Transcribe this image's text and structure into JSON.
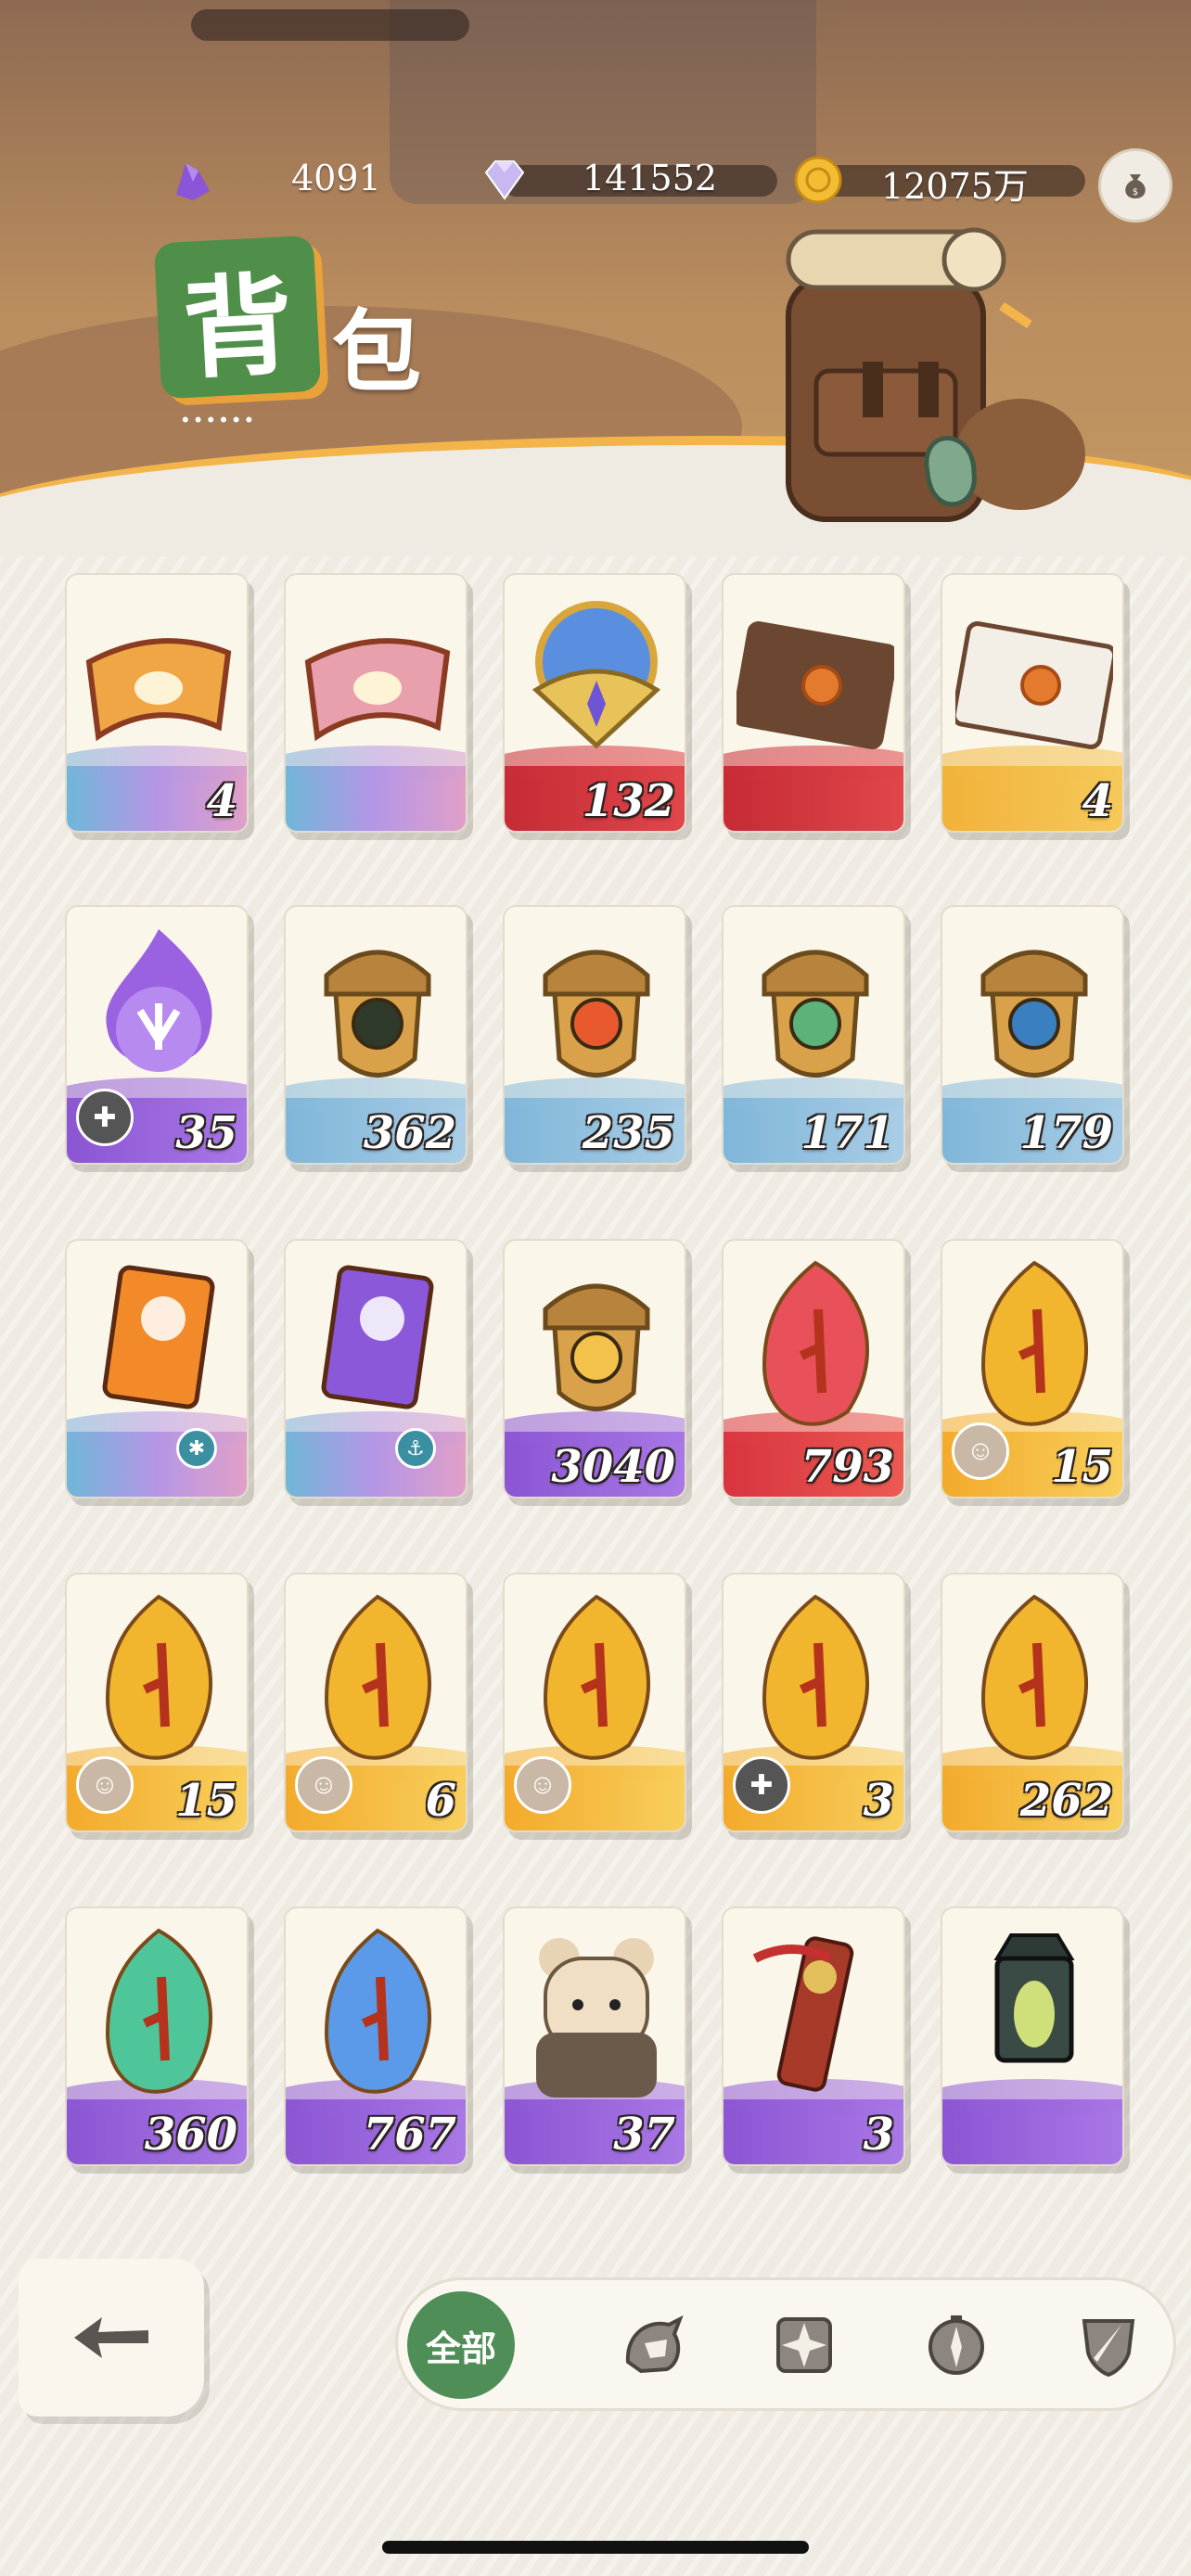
{
  "currencies": [
    {
      "name": "purple-crystal",
      "value": "4091",
      "color": "#8a55d6"
    },
    {
      "name": "diamond",
      "value": "141552",
      "color": "#c9b7f2"
    },
    {
      "name": "gold-coin",
      "value": "12075万",
      "color": "#f2bd32"
    }
  ],
  "title": {
    "main_char": "背",
    "rest": "包",
    "dots": "••••••"
  },
  "items": [
    {
      "icon": "ticket-orange-icon",
      "qty": "4",
      "band": "blue"
    },
    {
      "icon": "ticket-pink-icon",
      "qty": "",
      "band": "blue"
    },
    {
      "icon": "crystal-orb-icon",
      "qty": "132",
      "band": "red"
    },
    {
      "icon": "envelope-dark-icon",
      "qty": "",
      "band": "red"
    },
    {
      "icon": "envelope-white-icon",
      "qty": "4",
      "band": "gold"
    },
    {
      "icon": "purple-flame-orb-icon",
      "qty": "35",
      "band": "purple",
      "badge": "puzzle-icon"
    },
    {
      "icon": "acorn-eye-icon",
      "qty": "362",
      "band": "sky"
    },
    {
      "icon": "acorn-sun-icon",
      "qty": "235",
      "band": "sky"
    },
    {
      "icon": "acorn-leaf-icon",
      "qty": "171",
      "band": "sky"
    },
    {
      "icon": "acorn-star-icon",
      "qty": "179",
      "band": "sky"
    },
    {
      "icon": "orange-ticket-scroll-icon",
      "qty": "",
      "band": "blue",
      "badge": "snowflake-icon"
    },
    {
      "icon": "purple-ticket-scroll-icon",
      "qty": "",
      "band": "blue",
      "badge": "anchor-icon"
    },
    {
      "icon": "acorn-diamond-icon",
      "qty": "3040",
      "band": "purple"
    },
    {
      "icon": "red-seed-icon",
      "qty": "793",
      "band": "redsoft"
    },
    {
      "icon": "gold-seed-icon",
      "qty": "15",
      "band": "goldsoft",
      "badge": "avatar-icon"
    },
    {
      "icon": "gold-seed-icon",
      "qty": "15",
      "band": "goldsoft",
      "badge": "avatar-icon"
    },
    {
      "icon": "gold-seed-icon",
      "qty": "6",
      "band": "goldsoft",
      "badge": "avatar-icon"
    },
    {
      "icon": "gold-seed-icon",
      "qty": "",
      "band": "goldsoft",
      "badge": "avatar-icon"
    },
    {
      "icon": "gold-seed-icon",
      "qty": "3",
      "band": "goldsoft",
      "badge": "puzzle-icon"
    },
    {
      "icon": "gold-seed-icon",
      "qty": "262",
      "band": "goldsoft"
    },
    {
      "icon": "green-seed-icon",
      "qty": "360",
      "band": "purple"
    },
    {
      "icon": "blue-seed-icon",
      "qty": "767",
      "band": "purple"
    },
    {
      "icon": "bear-plush-icon",
      "qty": "37",
      "band": "purple"
    },
    {
      "icon": "red-sash-totem-icon",
      "qty": "3",
      "band": "purple"
    },
    {
      "icon": "lantern-icon",
      "qty": "",
      "band": "purple"
    }
  ],
  "filters": [
    {
      "label": "全部",
      "icon": "all-filter",
      "active": true
    },
    {
      "label": "",
      "icon": "helmet-icon",
      "active": false
    },
    {
      "label": "",
      "icon": "shuriken-icon",
      "active": false
    },
    {
      "label": "",
      "icon": "compass-icon",
      "active": false
    },
    {
      "label": "",
      "icon": "shield-sword-icon",
      "active": false
    }
  ]
}
